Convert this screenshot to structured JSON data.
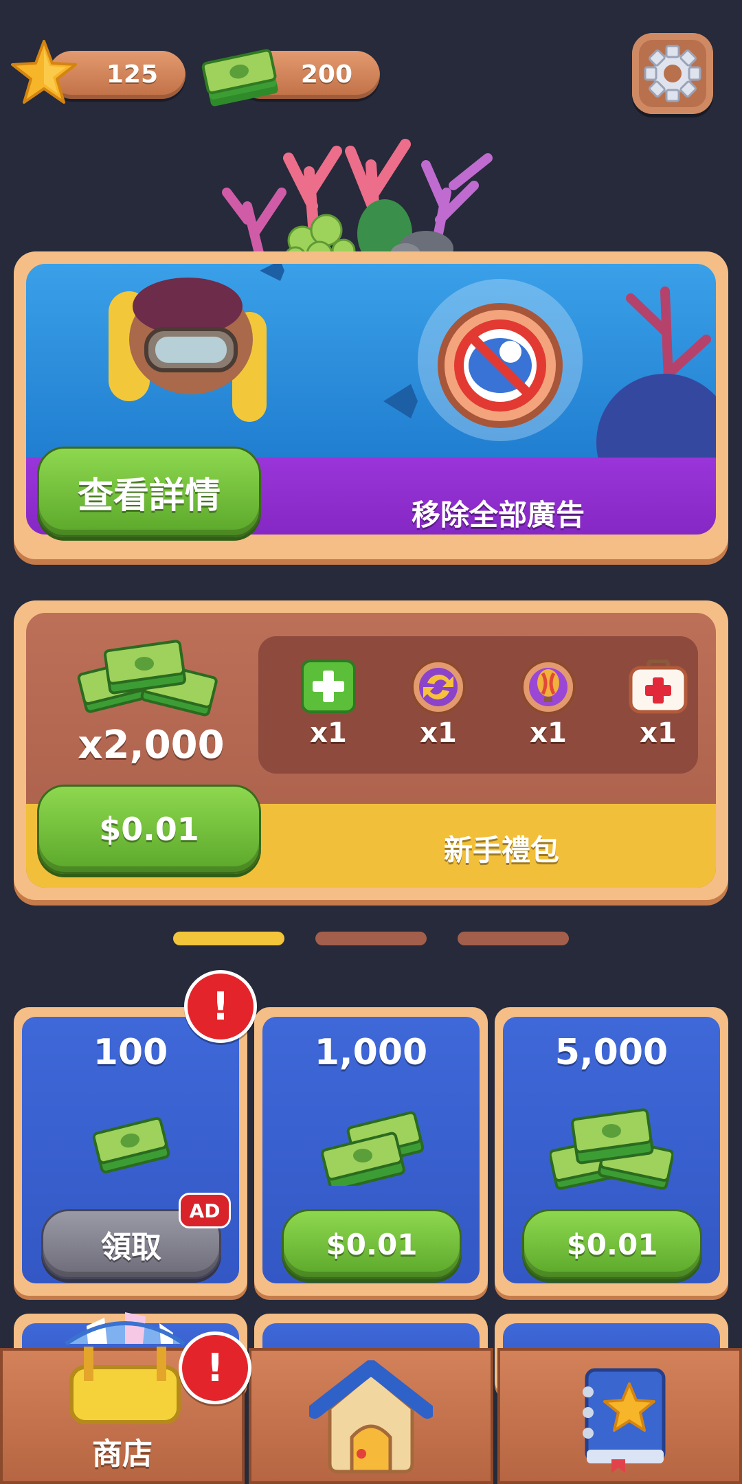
{
  "top_bar": {
    "stars": "125",
    "cash": "200"
  },
  "banner": {
    "details_button": "查看詳情",
    "title": "移除全部廣告"
  },
  "starter_pack": {
    "cash_amount": "x2,000",
    "items": [
      {
        "icon": "green-plus-icon",
        "count": "x1"
      },
      {
        "icon": "swap-icon",
        "count": "x1"
      },
      {
        "icon": "balloon-icon",
        "count": "x1"
      },
      {
        "icon": "medkit-icon",
        "count": "x1"
      }
    ],
    "price_button": "$0.01",
    "title": "新手禮包"
  },
  "pager": {
    "pages": 3,
    "active_page": 1
  },
  "shop_items": [
    {
      "amount": "100",
      "button": "領取",
      "badge": "AD",
      "alert": "!"
    },
    {
      "amount": "1,000",
      "button": "$0.01"
    },
    {
      "amount": "5,000",
      "button": "$0.01"
    }
  ],
  "bottom_nav": {
    "shop_label": "商店",
    "shop_alert": "!"
  },
  "colors": {
    "background": "#262a3a",
    "purple_strip": "#9a35d9",
    "yellow_strip": "#f2bf3a",
    "green_button": "#6cbc33",
    "shop_blue": "#3a60d0",
    "alert_red": "#e3252b"
  }
}
